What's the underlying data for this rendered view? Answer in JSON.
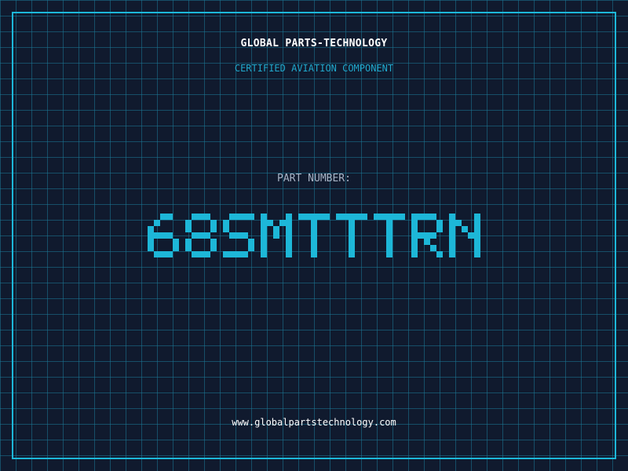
{
  "header": {
    "company": "GLOBAL PARTS-TECHNOLOGY",
    "tagline": "CERTIFIED AVIATION COMPONENT"
  },
  "part": {
    "label": "PART NUMBER:",
    "number": "68SMTTTRN"
  },
  "footer": {
    "website": "www.globalpartstechnology.com"
  },
  "colors": {
    "background": "#101a2e",
    "grid": "#1c7896",
    "accent": "#1db7d8",
    "text": "#ffffff",
    "muted": "#a8b4c6"
  }
}
